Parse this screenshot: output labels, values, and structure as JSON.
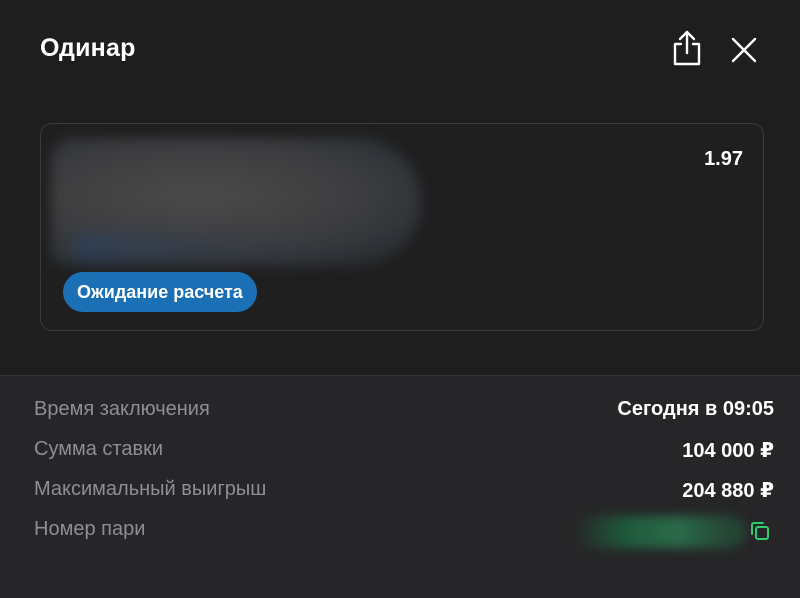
{
  "header": {
    "title": "Одинар",
    "share_icon": "share-icon",
    "close_icon": "close-icon"
  },
  "bet": {
    "odds": "1.97",
    "status": "Ожидание расчета"
  },
  "details": {
    "rows": [
      {
        "label": "Время заключения",
        "value": "Сегодня в 09:05"
      },
      {
        "label": "Сумма ставки",
        "value": "104 000 ₽"
      },
      {
        "label": "Максимальный выигрыш",
        "value": "204 880 ₽"
      },
      {
        "label": "Номер пари",
        "value": ""
      }
    ],
    "copy_icon": "copy-icon"
  },
  "colors": {
    "background": "#1e1e1f",
    "details_background": "#262628",
    "status_badge": "#1b6fb5",
    "copy_accent": "#2ecc71",
    "label_text": "#8e8e93",
    "value_text": "#ffffff"
  }
}
